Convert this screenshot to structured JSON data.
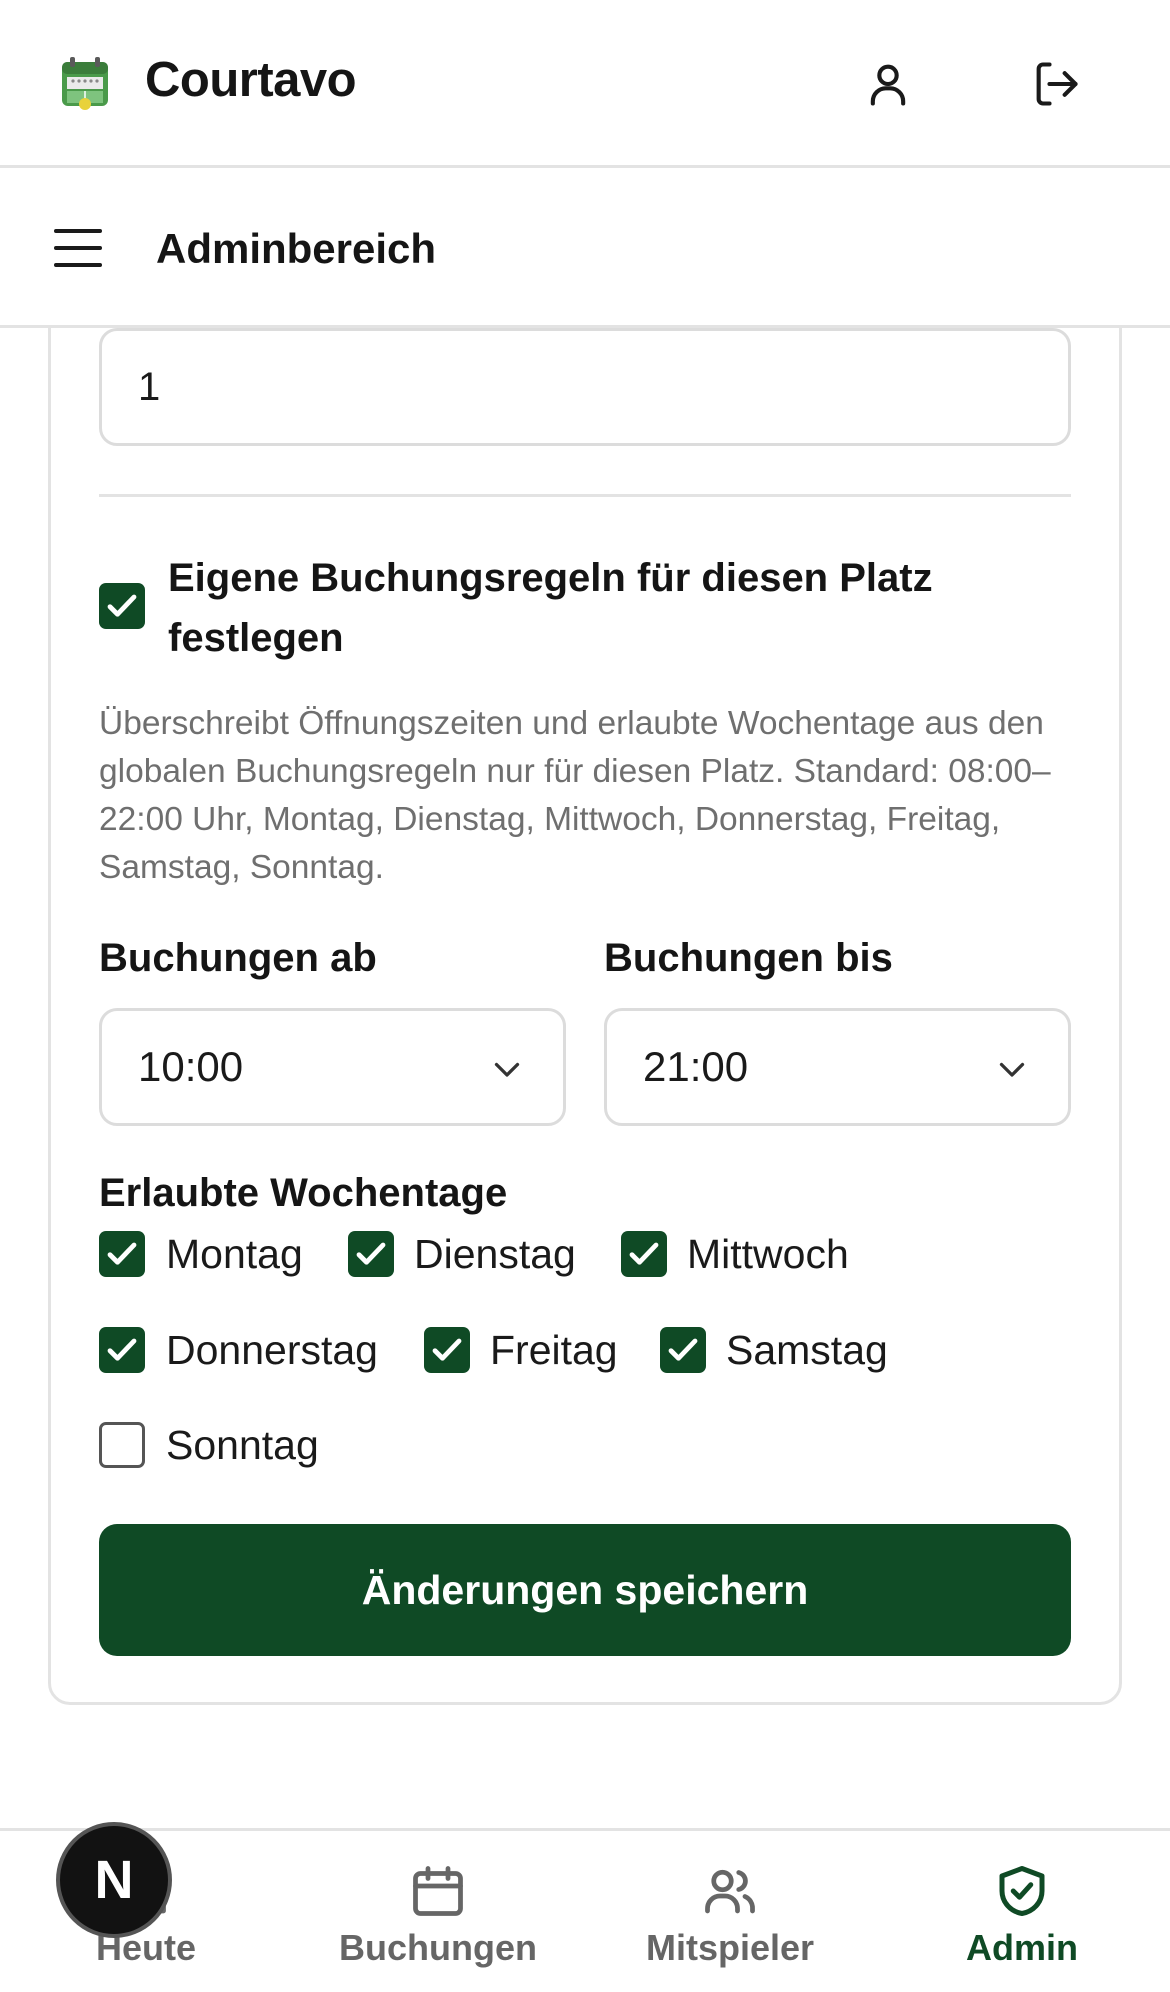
{
  "header": {
    "app_name": "Courtavo",
    "logo_icon": "calendar-court-logo",
    "profile_icon": "user-icon",
    "logout_icon": "logout-icon"
  },
  "subheader": {
    "title": "Adminbereich",
    "menu_icon": "hamburger-menu-icon"
  },
  "form": {
    "number_value": "1",
    "custom_rules": {
      "checked": true,
      "label": "Eigene Buchungsregeln für diesen Platz festlegen",
      "help": "Überschreibt Öffnungszeiten und erlaubte Wochentage aus den globalen Buchungsregeln nur für diesen Platz. Standard: 08:00–22:00 Uhr, Montag, Dienstag, Mittwoch, Donnerstag, Freitag, Samstag, Sonntag."
    },
    "from": {
      "label": "Buchungen ab",
      "value": "10:00"
    },
    "to": {
      "label": "Buchungen bis",
      "value": "21:00"
    },
    "weekdays": {
      "label": "Erlaubte Wochentage",
      "days": [
        {
          "label": "Montag",
          "checked": true
        },
        {
          "label": "Dienstag",
          "checked": true
        },
        {
          "label": "Mittwoch",
          "checked": true
        },
        {
          "label": "Donnerstag",
          "checked": true
        },
        {
          "label": "Freitag",
          "checked": true
        },
        {
          "label": "Samstag",
          "checked": true
        },
        {
          "label": "Sonntag",
          "checked": false
        }
      ]
    },
    "save_label": "Änderungen speichern"
  },
  "nav": {
    "items": [
      {
        "label": "Heute",
        "icon": "home-icon",
        "active": false
      },
      {
        "label": "Buchungen",
        "icon": "calendar-icon",
        "active": false
      },
      {
        "label": "Mitspieler",
        "icon": "users-icon",
        "active": false
      },
      {
        "label": "Admin",
        "icon": "shield-check-icon",
        "active": true
      }
    ]
  },
  "dev_badge": {
    "letter": "N"
  },
  "colors": {
    "primary": "#0f4a25",
    "muted_text": "#6f6f6f",
    "border": "#dcdcdc"
  }
}
